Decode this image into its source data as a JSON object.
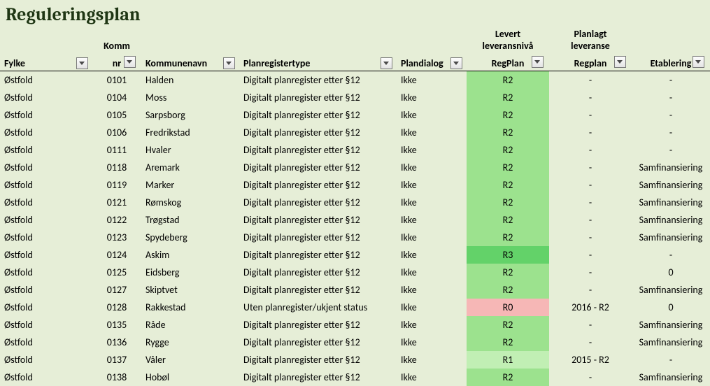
{
  "title": "Reguleringsplan",
  "headers": {
    "fylke": "Fylke",
    "komm_top": "Komm",
    "komm_nr": "nr",
    "kommunenavn": "Kommunenavn",
    "planregistertype": "Planregistertype",
    "plandialog": "Plandialog",
    "levert_top1": "Levert",
    "levert_top2": "leveransnivå",
    "regplan": "RegPlan",
    "planlagt_top1": "Planlagt",
    "planlagt_top2": "leveranse",
    "regplan2": "Regplan",
    "etablering": "Etablering"
  },
  "rows": [
    {
      "fylke": "Østfold",
      "nr": "0101",
      "navn": "Halden",
      "plan": "Digitalt planregister etter §12",
      "dialog": "Ikke",
      "lev": "R2",
      "plg": "-",
      "eta": "-"
    },
    {
      "fylke": "Østfold",
      "nr": "0104",
      "navn": "Moss",
      "plan": "Digitalt planregister etter §12",
      "dialog": "Ikke",
      "lev": "R2",
      "plg": "-",
      "eta": "-"
    },
    {
      "fylke": "Østfold",
      "nr": "0105",
      "navn": "Sarpsborg",
      "plan": "Digitalt planregister etter §12",
      "dialog": "Ikke",
      "lev": "R2",
      "plg": "-",
      "eta": "-"
    },
    {
      "fylke": "Østfold",
      "nr": "0106",
      "navn": "Fredrikstad",
      "plan": "Digitalt planregister etter §12",
      "dialog": "Ikke",
      "lev": "R2",
      "plg": "-",
      "eta": "-"
    },
    {
      "fylke": "Østfold",
      "nr": "0111",
      "navn": "Hvaler",
      "plan": "Digitalt planregister etter §12",
      "dialog": "Ikke",
      "lev": "R2",
      "plg": "-",
      "eta": "-"
    },
    {
      "fylke": "Østfold",
      "nr": "0118",
      "navn": "Aremark",
      "plan": "Digitalt planregister etter §12",
      "dialog": "Ikke",
      "lev": "R2",
      "plg": "-",
      "eta": "Samfinansiering"
    },
    {
      "fylke": "Østfold",
      "nr": "0119",
      "navn": "Marker",
      "plan": "Digitalt planregister etter §12",
      "dialog": "Ikke",
      "lev": "R2",
      "plg": "-",
      "eta": "Samfinansiering"
    },
    {
      "fylke": "Østfold",
      "nr": "0121",
      "navn": "Rømskog",
      "plan": "Digitalt planregister etter §12",
      "dialog": "Ikke",
      "lev": "R2",
      "plg": "-",
      "eta": "Samfinansiering"
    },
    {
      "fylke": "Østfold",
      "nr": "0122",
      "navn": "Trøgstad",
      "plan": "Digitalt planregister etter §12",
      "dialog": "Ikke",
      "lev": "R2",
      "plg": "-",
      "eta": "Samfinansiering"
    },
    {
      "fylke": "Østfold",
      "nr": "0123",
      "navn": "Spydeberg",
      "plan": "Digitalt planregister etter §12",
      "dialog": "Ikke",
      "lev": "R2",
      "plg": "-",
      "eta": "Samfinansiering"
    },
    {
      "fylke": "Østfold",
      "nr": "0124",
      "navn": "Askim",
      "plan": "Digitalt planregister etter §12",
      "dialog": "Ikke",
      "lev": "R3",
      "plg": "-",
      "eta": "-"
    },
    {
      "fylke": "Østfold",
      "nr": "0125",
      "navn": "Eidsberg",
      "plan": "Digitalt planregister etter §12",
      "dialog": "Ikke",
      "lev": "R2",
      "plg": "-",
      "eta": "0"
    },
    {
      "fylke": "Østfold",
      "nr": "0127",
      "navn": "Skiptvet",
      "plan": "Digitalt planregister etter §12",
      "dialog": "Ikke",
      "lev": "R2",
      "plg": "-",
      "eta": "Samfinansiering"
    },
    {
      "fylke": "Østfold",
      "nr": "0128",
      "navn": "Rakkestad",
      "plan": "Uten planregister/ukjent status",
      "dialog": "Ikke",
      "lev": "R0",
      "plg": "2016  -  R2",
      "eta": "0"
    },
    {
      "fylke": "Østfold",
      "nr": "0135",
      "navn": "Råde",
      "plan": "Digitalt planregister etter §12",
      "dialog": "Ikke",
      "lev": "R2",
      "plg": "-",
      "eta": "Samfinansiering"
    },
    {
      "fylke": "Østfold",
      "nr": "0136",
      "navn": "Rygge",
      "plan": "Digitalt planregister etter §12",
      "dialog": "Ikke",
      "lev": "R2",
      "plg": "-",
      "eta": "Samfinansiering"
    },
    {
      "fylke": "Østfold",
      "nr": "0137",
      "navn": "Våler",
      "plan": "Digitalt planregister etter §12",
      "dialog": "Ikke",
      "lev": "R1",
      "plg": "2015  -  R2",
      "eta": "-"
    },
    {
      "fylke": "Østfold",
      "nr": "0138",
      "navn": "Hobøl",
      "plan": "Digitalt planregister etter §12",
      "dialog": "Ikke",
      "lev": "R2",
      "plg": "-",
      "eta": "Samfinansiering"
    }
  ]
}
